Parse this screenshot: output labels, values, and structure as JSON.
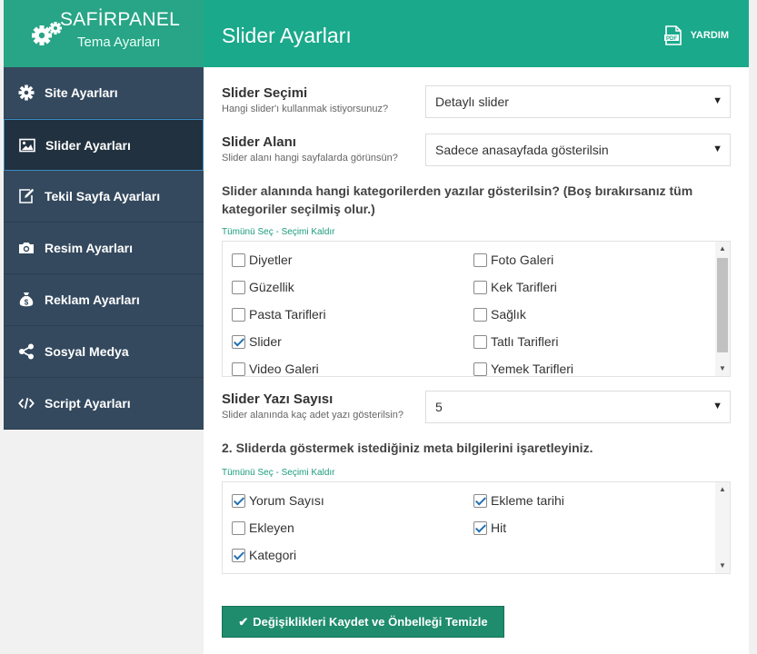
{
  "brand": {
    "name": "SAFİRPANEL",
    "subtitle": "Tema Ayarları"
  },
  "header": {
    "title": "Slider Ayarları",
    "help_label": "YARDIM"
  },
  "sidebar": {
    "items": [
      {
        "label": "Site Ayarları",
        "icon": "gear-icon"
      },
      {
        "label": "Slider Ayarları",
        "icon": "image-icon"
      },
      {
        "label": "Tekil Sayfa Ayarları",
        "icon": "edit-icon"
      },
      {
        "label": "Resim Ayarları",
        "icon": "camera-icon"
      },
      {
        "label": "Reklam Ayarları",
        "icon": "money-bag-icon"
      },
      {
        "label": "Sosyal Medya",
        "icon": "share-icon"
      },
      {
        "label": "Script Ayarları",
        "icon": "code-icon"
      }
    ],
    "active_index": 1
  },
  "form": {
    "slider_choice": {
      "title": "Slider Seçimi",
      "desc": "Hangi slider'ı kullanmak istiyorsunuz?",
      "value": "Detaylı slider"
    },
    "slider_area": {
      "title": "Slider Alanı",
      "desc": "Slider alanı hangi sayfalarda görünsün?",
      "value": "Sadece anasayfada gösterilsin"
    },
    "categories_question": "Slider alanında hangi kategorilerden yazılar gösterilsin? (Boş bırakırsanız tüm kategoriler seçilmiş olur.)",
    "select_all": "Tümünü Seç",
    "separator": " - ",
    "deselect": "Seçimi Kaldır",
    "categories": [
      {
        "label": "Diyetler",
        "checked": false
      },
      {
        "label": "Foto Galeri",
        "checked": false
      },
      {
        "label": "Güzellik",
        "checked": false
      },
      {
        "label": "Kek Tarifleri",
        "checked": false
      },
      {
        "label": "Pasta Tarifleri",
        "checked": false
      },
      {
        "label": "Sağlık",
        "checked": false
      },
      {
        "label": "Slider",
        "checked": true
      },
      {
        "label": "Tatlı Tarifleri",
        "checked": false
      },
      {
        "label": "Video Galeri",
        "checked": false
      },
      {
        "label": "Yemek Tarifleri",
        "checked": false
      }
    ],
    "post_count": {
      "title": "Slider Yazı Sayısı",
      "desc": "Slider alanında kaç adet yazı gösterilsin?",
      "value": "5"
    },
    "meta_question": "2. Sliderda göstermek istediğiniz meta bilgilerini işaretleyiniz.",
    "meta": [
      {
        "label": "Yorum Sayısı",
        "checked": true
      },
      {
        "label": "Ekleme tarihi",
        "checked": true
      },
      {
        "label": "Ekleyen",
        "checked": false
      },
      {
        "label": "Hit",
        "checked": true
      },
      {
        "label": "Kategori",
        "checked": true
      }
    ],
    "save_label": "Değişiklikleri Kaydet ve Önbelleği Temizle"
  },
  "colors": {
    "accent": "#1aa98b",
    "sidebar": "#34495e",
    "sidebar_active": "#22313f",
    "button": "#1e8c6d"
  }
}
